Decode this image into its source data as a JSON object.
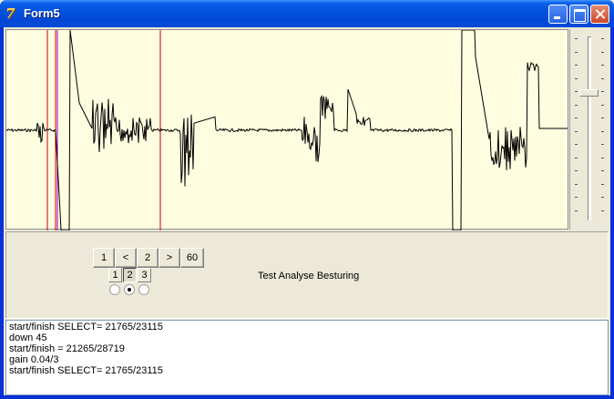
{
  "window": {
    "title": "Form5",
    "icon": "delphi-app-icon",
    "controls": [
      "minimize-icon",
      "maximize-icon",
      "close-icon"
    ]
  },
  "plot": {
    "background": "#fffde0",
    "waveform_color": "#000000",
    "marker_colors": [
      "#cc0000",
      "#cc0000",
      "#9900cc",
      "#cc0000"
    ]
  },
  "navigation": {
    "buttons": [
      "1",
      "<",
      "2",
      ">",
      "60"
    ],
    "mode_buttons": [
      "1",
      "2",
      "3"
    ],
    "mode_pressed_index": 1,
    "mode_radio_selected_index": 1
  },
  "label": "Test Analyse Besturing",
  "memo": {
    "lines": [
      "start/finish SELECT= 21765/23115",
      "down 45",
      "start/finish = 21265/28719",
      "gain 0.04/3",
      "start/finish SELECT= 21765/23115"
    ]
  },
  "colors": {
    "titlebar": "#0453e0",
    "client": "#ece9d8",
    "close_button": "#cf4a2b"
  }
}
